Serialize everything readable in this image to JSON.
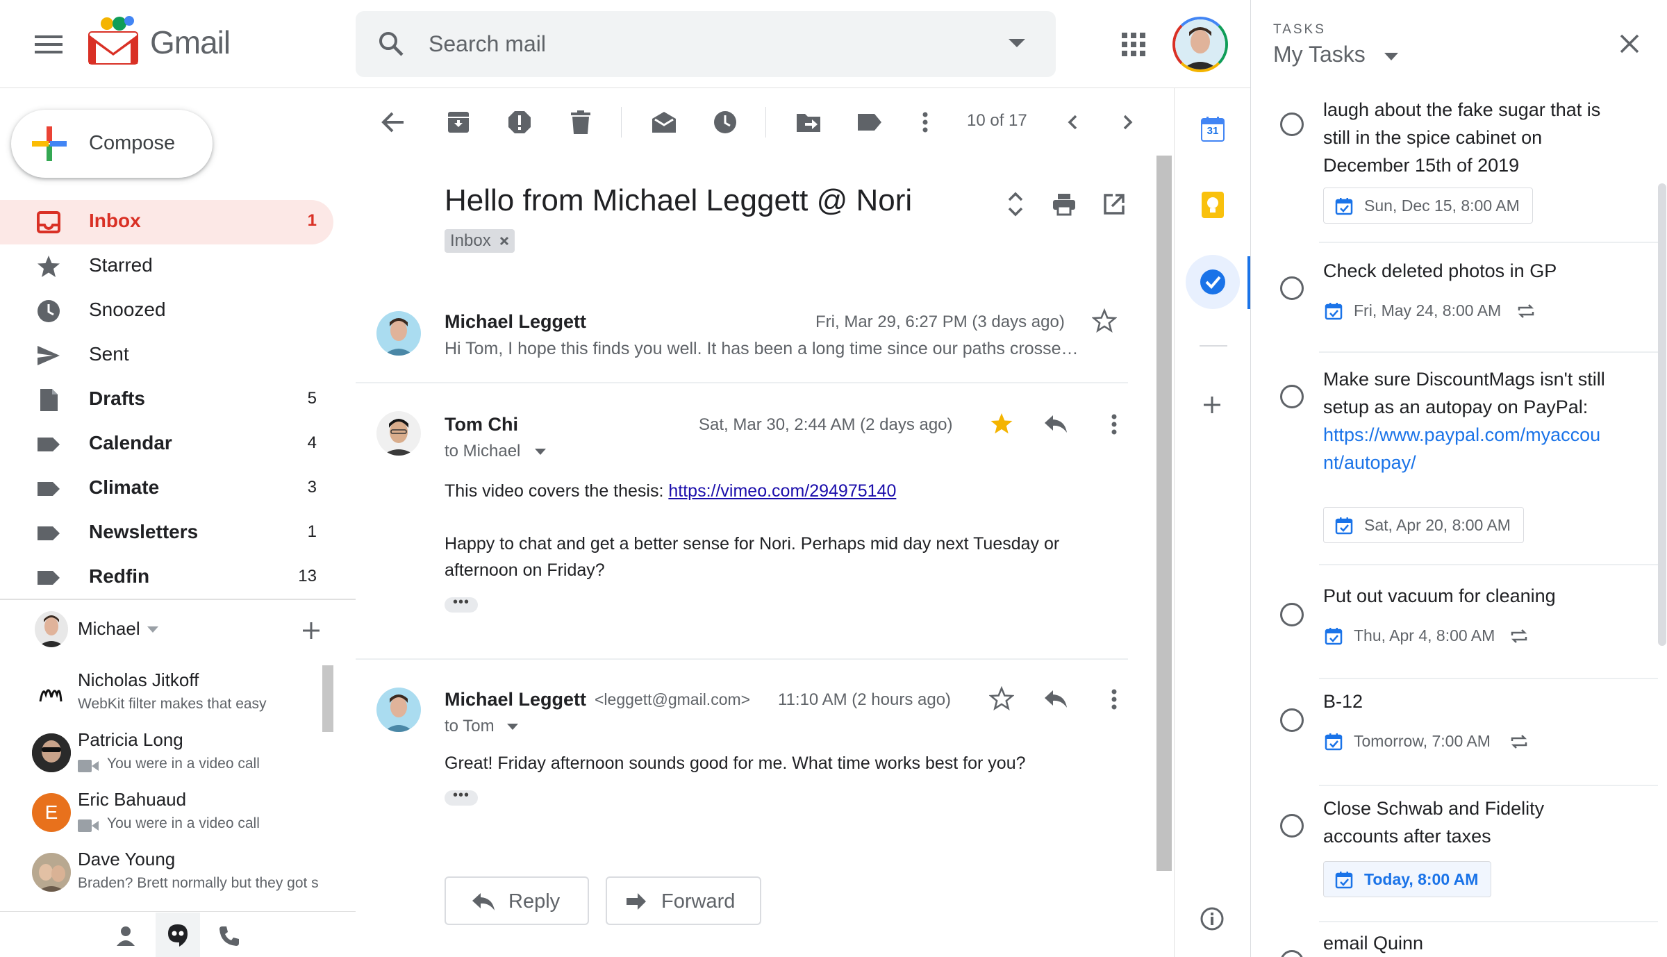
{
  "header": {
    "app_name": "Gmail",
    "search_placeholder": "Search mail"
  },
  "sidebar": {
    "compose_label": "Compose",
    "items": [
      {
        "label": "Inbox",
        "count": "1"
      },
      {
        "label": "Starred",
        "count": ""
      },
      {
        "label": "Snoozed",
        "count": ""
      },
      {
        "label": "Sent",
        "count": ""
      },
      {
        "label": "Drafts",
        "count": "5"
      },
      {
        "label": "Calendar",
        "count": "4"
      },
      {
        "label": "Climate",
        "count": "3"
      },
      {
        "label": "Newsletters",
        "count": "1"
      },
      {
        "label": "Redfin",
        "count": "13"
      }
    ]
  },
  "hangouts": {
    "current_user": "Michael",
    "contacts": [
      {
        "name": "Nicholas Jitkoff",
        "status": "WebKit filter makes that easy"
      },
      {
        "name": "Patricia Long",
        "status": "You were in a video call"
      },
      {
        "name": "Eric Bahuaud",
        "status": "You were in a video call",
        "initial": "E"
      },
      {
        "name": "Dave Young",
        "status": "Braden? Brett normally but they got s"
      }
    ]
  },
  "toolbar": {
    "pagination": "10 of 17"
  },
  "thread": {
    "subject": "Hello from Michael Leggett @ Nori",
    "label_chip": "Inbox",
    "messages": [
      {
        "sender": "Michael Leggett",
        "date": "Fri, Mar 29, 6:27 PM (3 days ago)",
        "snippet": "Hi Tom, I hope this finds you well. It has been a long time since our paths crosse…"
      },
      {
        "sender": "Tom Chi",
        "date": "Sat, Mar 30, 2:44 AM (2 days ago)",
        "to": "to Michael",
        "body_line1_prefix": "This video covers the thesis: ",
        "body_link": "https://vimeo.com/294975140",
        "body_line2": "Happy to chat and get a better sense for Nori.  Perhaps mid day next Tuesday or",
        "body_line3": "afternoon on Friday?",
        "starred": true
      },
      {
        "sender": "Michael Leggett",
        "email": "<leggett@gmail.com>",
        "date": "11:10 AM (2 hours ago)",
        "to": "to Tom",
        "body": "Great! Friday afternoon sounds good for me. What time works best for you?"
      }
    ],
    "reply_label": "Reply",
    "forward_label": "Forward"
  },
  "side_strip": {
    "calendar_day": "31"
  },
  "tasks": {
    "header_label": "TASKS",
    "list_name": "My Tasks",
    "items": [
      {
        "title": "laugh about the fake sugar that is still in the spice cabinet on December 15th of 2019",
        "date": "Sun, Dec 15, 8:00 AM",
        "repeat": false
      },
      {
        "title": "Check deleted photos in GP",
        "date": "Fri, May 24, 8:00 AM",
        "repeat": true
      },
      {
        "title": "Make sure DiscountMags isn't still setup as an autopay on PayPal:",
        "link": "https://www.paypal.com/myaccount/autopay/",
        "date": "Sat, Apr 20, 8:00 AM",
        "repeat": false
      },
      {
        "title": "Put out vacuum for cleaning",
        "date": "Thu, Apr 4, 8:00 AM",
        "repeat": true
      },
      {
        "title": "B-12",
        "date": "Tomorrow, 7:00 AM",
        "repeat": true
      },
      {
        "title": "Close Schwab and Fidelity accounts after taxes",
        "date": "Today, 8:00 AM",
        "repeat": false,
        "today": true
      },
      {
        "title": "email Quinn",
        "date": "",
        "repeat": false
      }
    ]
  },
  "colors": {
    "gmail_red": "#d93025",
    "link_blue": "#1a0dab",
    "star_yellow": "#f4b400",
    "tasks_blue": "#1a73e8"
  }
}
